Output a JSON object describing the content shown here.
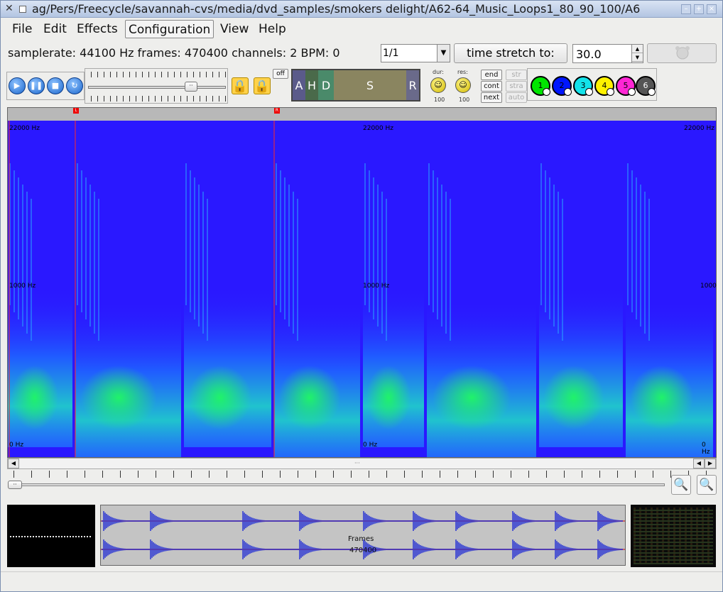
{
  "window": {
    "title": "ag/Pers/Freecycle/savannah-cvs/media/dvd_samples/smokers delight/A62-64_Music_Loops1_80_90_100/A6"
  },
  "menu": {
    "file": "File",
    "edit": "Edit",
    "effects": "Effects",
    "configuration": "Configuration",
    "view": "View",
    "help": "Help"
  },
  "info": {
    "summary": "samplerate: 44100 Hz frames: 470400 channels: 2 BPM: 0",
    "ratio": "1/1",
    "stretch_label": "time stretch to:",
    "stretch_value": "30.0"
  },
  "controls": {
    "off_label": "off",
    "adsr": [
      "A",
      "H",
      "D",
      "S",
      "R"
    ],
    "dur_label": "dur:",
    "res_label": "res:",
    "dur_value": "100",
    "res_value": "100",
    "end_label": "end",
    "cont_label": "cont",
    "next_label": "next",
    "str_label": "str",
    "stra_label": "stra",
    "auto_label": "auto",
    "channels": [
      "1",
      "2",
      "3",
      "4",
      "5",
      "6"
    ]
  },
  "colors": {
    "spectro_bg": "#2a18ff",
    "ch1": "#00e600",
    "ch2": "#0016ff",
    "ch3": "#13e3ea",
    "ch4": "#fff200",
    "ch5": "#ff26d4",
    "ch6": "#555555"
  },
  "spectrogram": {
    "freq_top": "22000 Hz",
    "freq_mid": "1000 Hz",
    "freq_bottom": "0 Hz",
    "freq_mid_right": "1000",
    "marker_left": "L",
    "marker_right": "R"
  },
  "overview": {
    "frames_label": "Frames",
    "frames_count": "470400"
  }
}
